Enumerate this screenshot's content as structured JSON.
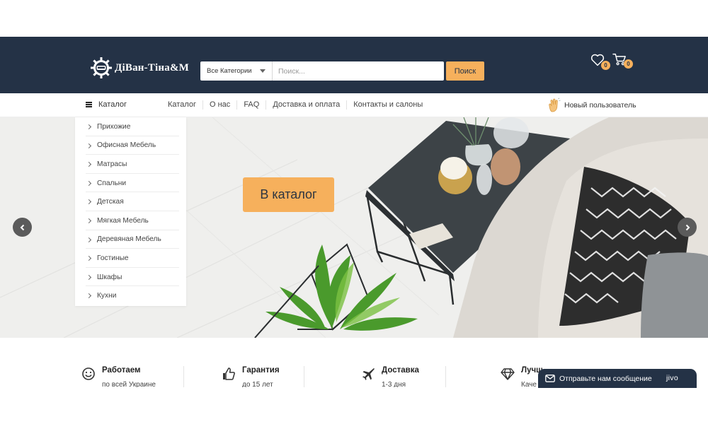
{
  "header": {
    "logo_text": "ДіВан-Тіна&М",
    "search": {
      "category_selected": "Все Категории",
      "placeholder": "Поиск...",
      "button_label": "Поиск"
    },
    "wishlist_count": "0",
    "cart_count": "0"
  },
  "nav": {
    "catalog_toggle_label": "Каталог",
    "menu": [
      "Каталог",
      "О нас",
      "FAQ",
      "Доставка и оплата",
      "Контакты и салоны"
    ],
    "user_label": "Новый пользователь"
  },
  "categories": [
    "Прихожие",
    "Офисная Мебель",
    "Матрасы",
    "Спальни",
    "Детская",
    "Мягкая Мебель",
    "Деревяная Мебель",
    "Гостиные",
    "Шкафы",
    "Кухни"
  ],
  "hero": {
    "cta_label": "В каталог"
  },
  "features": [
    {
      "icon": "smile-icon",
      "title": "Работаем",
      "subtitle": "по всей Украине"
    },
    {
      "icon": "thumbs-up-icon",
      "title": "Гарантия",
      "subtitle": "до 15 лет"
    },
    {
      "icon": "airplane-icon",
      "title": "Доставка",
      "subtitle": "1-3 дня"
    },
    {
      "icon": "diamond-icon",
      "title": "Лучш",
      "subtitle": "Каче"
    }
  ],
  "chat": {
    "label": "Отправьте нам сообщение",
    "brand": "jivo"
  },
  "colors": {
    "header_bg": "#243246",
    "accent": "#f6b05c"
  }
}
